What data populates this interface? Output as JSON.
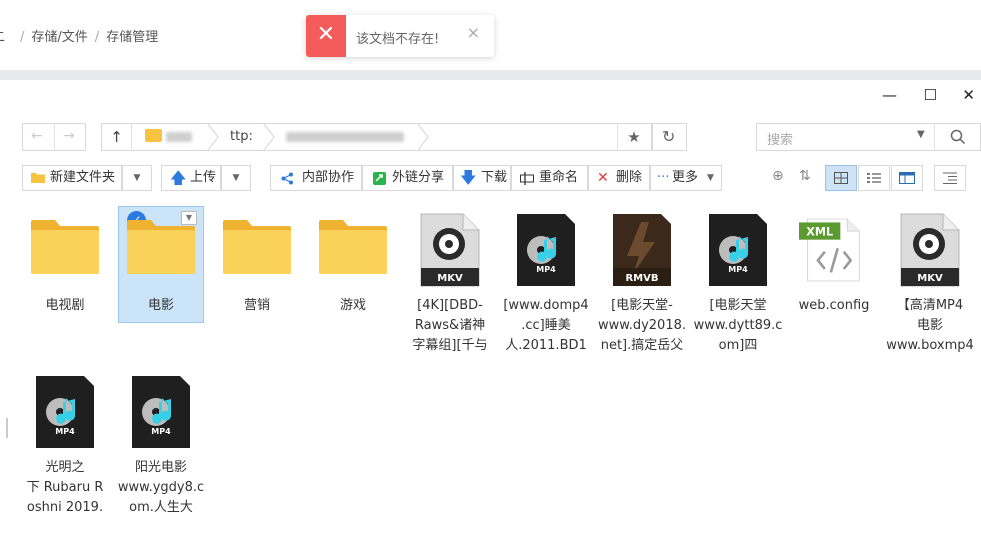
{
  "breadcrumb": {
    "items": [
      "二",
      "存储/文件",
      "存储管理"
    ],
    "separator": "/"
  },
  "toast": {
    "icon": "close-icon",
    "message": "该文档不存在!",
    "close": "×",
    "color": "#f45b5b"
  },
  "window": {
    "minimize": "—",
    "maximize": "☐",
    "close": "✕"
  },
  "address": {
    "back": "←",
    "forward": "→",
    "up": "↑",
    "protocol": "ttp:",
    "star": "★",
    "refresh": "↻"
  },
  "search": {
    "placeholder": "搜索",
    "dropdown": "▼"
  },
  "toolbar": {
    "new_folder": "新建文件夹",
    "upload": "上传",
    "internal_collab": "内部协作",
    "external_share": "外链分享",
    "download": "下载",
    "rename": "重命名",
    "delete": "删除",
    "more": "更多"
  },
  "files": [
    {
      "name": "电视剧",
      "type": "folder"
    },
    {
      "name": "电影",
      "type": "folder",
      "selected": true
    },
    {
      "name": "营销",
      "type": "folder"
    },
    {
      "name": "游戏",
      "type": "folder"
    },
    {
      "name": "[4K][DBD-\nRaws&诸神\n字幕组][千与",
      "type": "MKV"
    },
    {
      "name": "[www.domp4\n.cc]睡美\n人.2011.BD1",
      "type": "MP4"
    },
    {
      "name": "[电影天堂-\nwww.dy2018.\nnet].搞定岳父",
      "type": "RMVB"
    },
    {
      "name": "[电影天堂\nwww.dytt89.c\nom]四",
      "type": "MP4"
    },
    {
      "name": "web.config",
      "type": "XML"
    },
    {
      "name": "【高清MP4\n电影\nwww.boxmp4",
      "type": "MKV"
    },
    {
      "name": "光明之\n下 Rubaru R\noshni 2019.",
      "type": "MP4"
    },
    {
      "name": "阳光电影\nwww.ygdy8.c\nom.人生大",
      "type": "MP4"
    }
  ],
  "colors": {
    "folder": "#f9c744",
    "selection": "#cce4f7",
    "accent": "#2b7ae0"
  }
}
